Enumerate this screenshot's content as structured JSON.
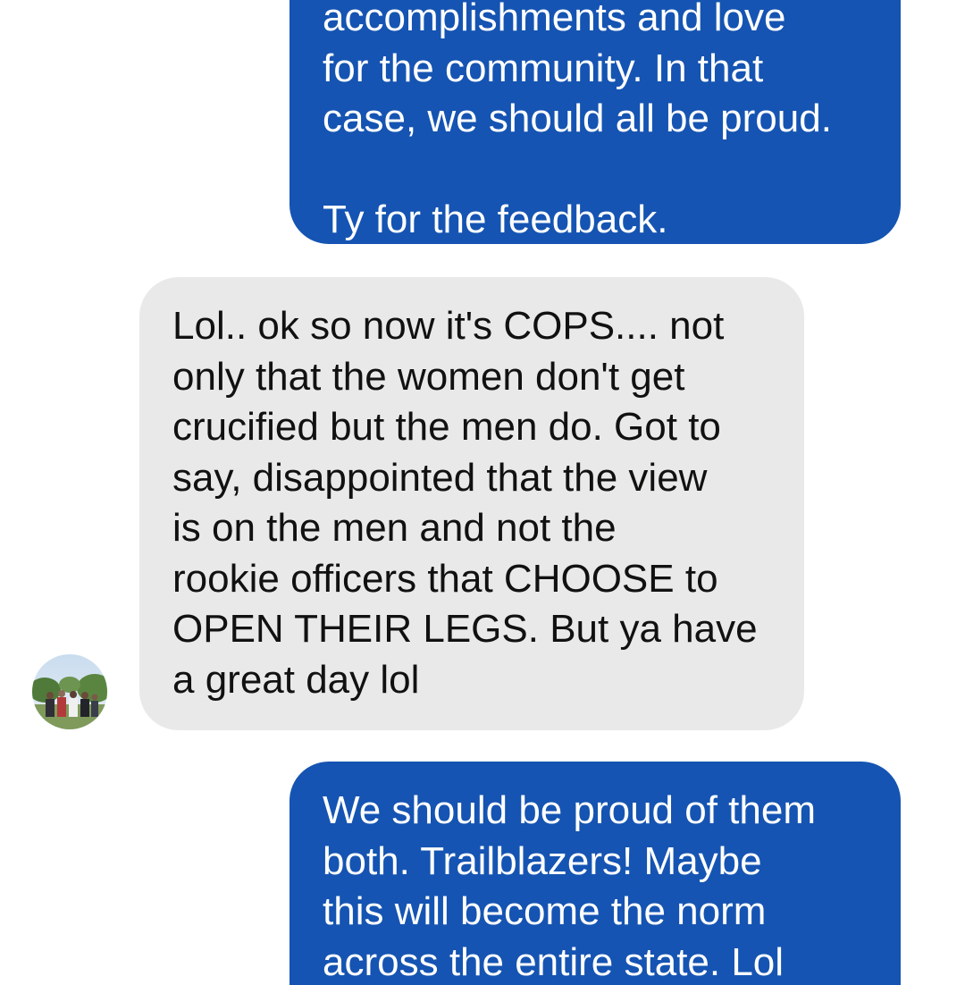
{
  "colors": {
    "outgoing_bubble": "#1554b2",
    "incoming_bubble": "#e9e9ea",
    "outgoing_text": "#ffffff",
    "incoming_text": "#111111"
  },
  "messages": [
    {
      "sender": "me",
      "text": "accomplishments and love\nfor the community.   In that\ncase, we should all be proud.\n\nTy for the feedback."
    },
    {
      "sender": "contact",
      "text": "Lol.. ok so now it's COPS.... not\nonly that the women don't get\ncrucified but the men do. Got to\nsay, disappointed that the view\nis on the men and not the\nrookie officers that CHOOSE to\nOPEN THEIR LEGS. But ya have\na great day lol"
    },
    {
      "sender": "me",
      "text": "We should be proud of them\nboth.  Trailblazers!   Maybe\nthis will become the norm\nacross the entire state.  Lol"
    }
  ],
  "contact": {
    "avatar_icon": "group-photo-avatar"
  }
}
